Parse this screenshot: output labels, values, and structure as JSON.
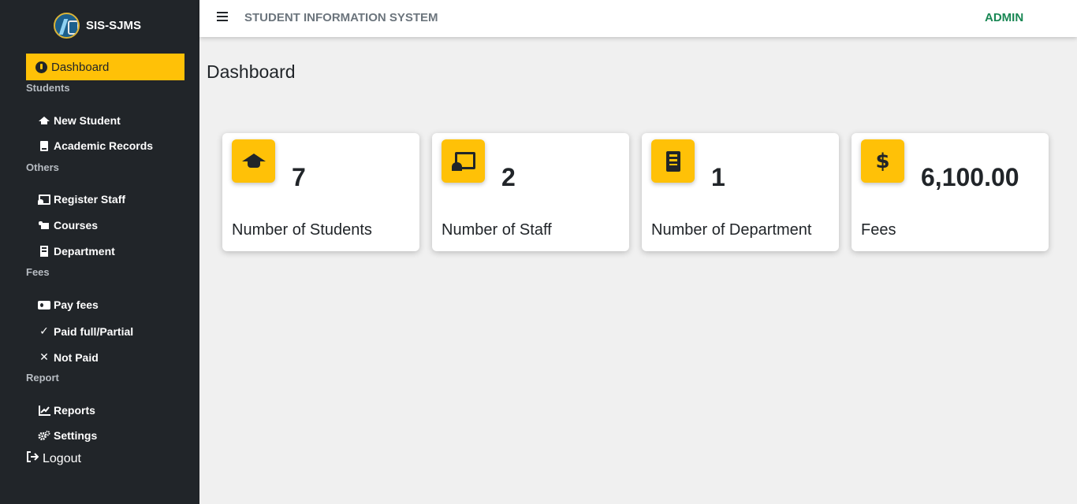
{
  "brand": {
    "name": "SIS-SJMS"
  },
  "topbar": {
    "title": "STUDENT INFORMATION SYSTEM",
    "user": "ADMIN"
  },
  "sidebar": {
    "active": {
      "label": "Dashboard",
      "icon": "gauge-icon"
    },
    "sections": [
      {
        "title": "Students",
        "items": [
          {
            "label": "New Student",
            "icon": "graduation-cap-icon"
          },
          {
            "label": "Academic Records",
            "icon": "book-icon"
          }
        ]
      },
      {
        "title": "Others",
        "items": [
          {
            "label": "Register Staff",
            "icon": "chalkboard-teacher-icon"
          },
          {
            "label": "Courses",
            "icon": "scroll-icon"
          },
          {
            "label": "Department",
            "icon": "building-icon"
          }
        ]
      },
      {
        "title": "Fees",
        "items": [
          {
            "label": "Pay fees",
            "icon": "money-bill-icon"
          },
          {
            "label": "Paid full/Partial",
            "icon": "check-icon"
          },
          {
            "label": "Not Paid",
            "icon": "x-icon"
          }
        ]
      },
      {
        "title": "Report",
        "items": [
          {
            "label": "Reports",
            "icon": "chart-line-icon"
          },
          {
            "label": "Settings",
            "icon": "gears-icon"
          }
        ]
      }
    ],
    "logout": {
      "label": "Logout",
      "icon": "logout-icon"
    }
  },
  "main": {
    "title": "Dashboard",
    "cards": [
      {
        "value": "7",
        "label": "Number of Students",
        "icon": "graduation-cap-icon"
      },
      {
        "value": "2",
        "label": "Number of Staff",
        "icon": "chalkboard-teacher-icon"
      },
      {
        "value": "1",
        "label": "Number of Department",
        "icon": "building-icon"
      },
      {
        "value": "6,100.00",
        "label": "Fees",
        "icon": "dollar-icon",
        "symbol": "$"
      }
    ]
  },
  "colors": {
    "sidebar": "#212529",
    "accent": "#ffc107",
    "admin": "#198754",
    "background": "#f0f0f0"
  }
}
